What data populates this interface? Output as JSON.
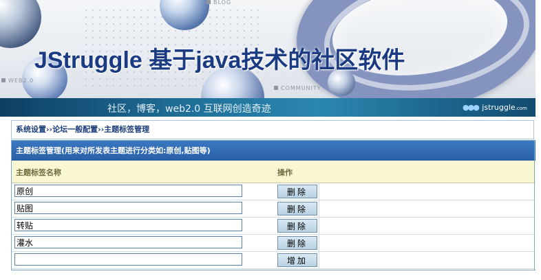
{
  "banner": {
    "title": "JStruggle 基于java技术的社区软件",
    "slogan": "社区，博客，web2.0 互联网创造奇迹",
    "brand": "jstruggle",
    "brand_suffix": ".com",
    "tag_blog": "BLOG",
    "tag_web": "WEB2.0",
    "tag_community": "COMMUNITY"
  },
  "breadcrumb": "系统设置››论坛一般配置››主题标签管理",
  "panel": {
    "title": "主题标签管理(用来对所发表主题进行分类如:原创,贴图等)",
    "col_name": "主题标签名称",
    "col_action": "操作"
  },
  "tags": [
    {
      "name": "原创",
      "action": "删除"
    },
    {
      "name": "贴图",
      "action": "删除"
    },
    {
      "name": "转贴",
      "action": "删除"
    },
    {
      "name": "灌水",
      "action": "删除"
    }
  ],
  "new_tag": {
    "value": "",
    "action": "增加"
  },
  "colors": {
    "header_blue": "#2a5fa7",
    "column_header_bg": "#f9f6d4",
    "button_bg": "#c8dcea",
    "breadcrumb_text": "#1b3d7a"
  }
}
